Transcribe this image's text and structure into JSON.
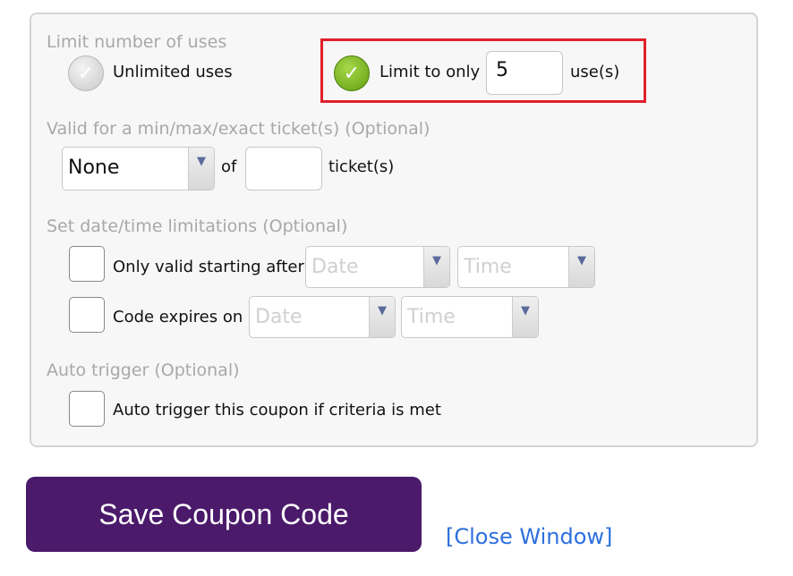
{
  "limit": {
    "header": "Limit number of uses",
    "unlimited_label": "Unlimited uses",
    "limit_label": "Limit to only",
    "limit_value": "5",
    "uses_suffix": "use(s)",
    "selected": "limit"
  },
  "tickets": {
    "header": "Valid for a min/max/exact ticket(s) (Optional)",
    "select_value": "None",
    "of_label": "of",
    "count_value": "",
    "suffix": "ticket(s)"
  },
  "dates": {
    "header": "Set date/time limitations (Optional)",
    "start_label": "Only valid starting after",
    "expire_label": "Code expires on",
    "date_placeholder": "Date",
    "time_placeholder": "Time"
  },
  "auto": {
    "header": "Auto trigger (Optional)",
    "label": "Auto trigger this coupon if criteria is met"
  },
  "actions": {
    "save_label": "Save Coupon Code",
    "close_label": "[Close Window]"
  },
  "colors": {
    "save_button": "#4b1a6b",
    "link": "#2d6fdf",
    "highlight": "#e0202a"
  }
}
